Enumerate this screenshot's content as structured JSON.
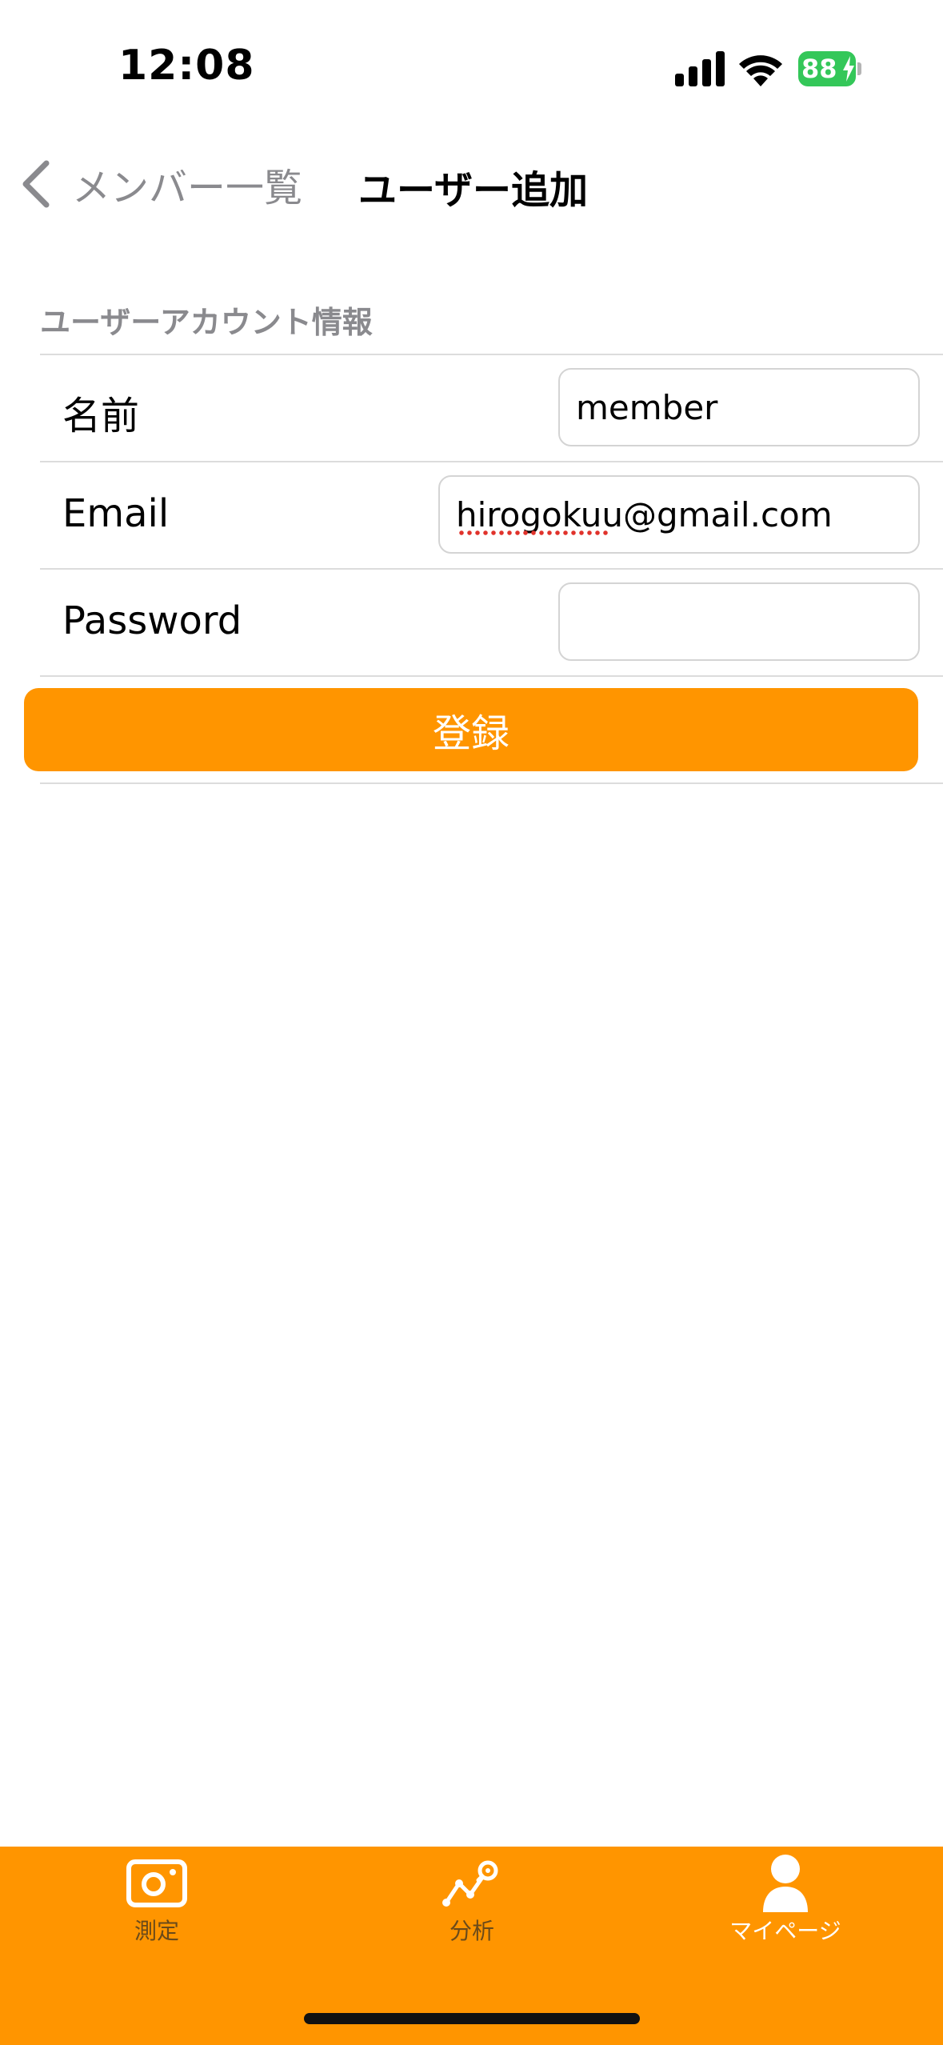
{
  "status_bar": {
    "time": "12:08",
    "battery": "88",
    "battery_color": "#34c759"
  },
  "nav": {
    "back_label": "メンバー一覧",
    "title": "ユーザー追加"
  },
  "section": {
    "header": "ユーザーアカウント情報"
  },
  "form": {
    "name_label": "名前",
    "name_value": "member",
    "email_label": "Email",
    "email_value": "hirogokuu@gmail.com",
    "password_label": "Password",
    "password_value": ""
  },
  "register_button": "登録",
  "accent_color": "#ff9500",
  "tabs": [
    {
      "label": "測定",
      "icon": "camera-icon",
      "active": false
    },
    {
      "label": "分析",
      "icon": "analytics-icon",
      "active": false
    },
    {
      "label": "マイページ",
      "icon": "person-icon",
      "active": true
    }
  ]
}
